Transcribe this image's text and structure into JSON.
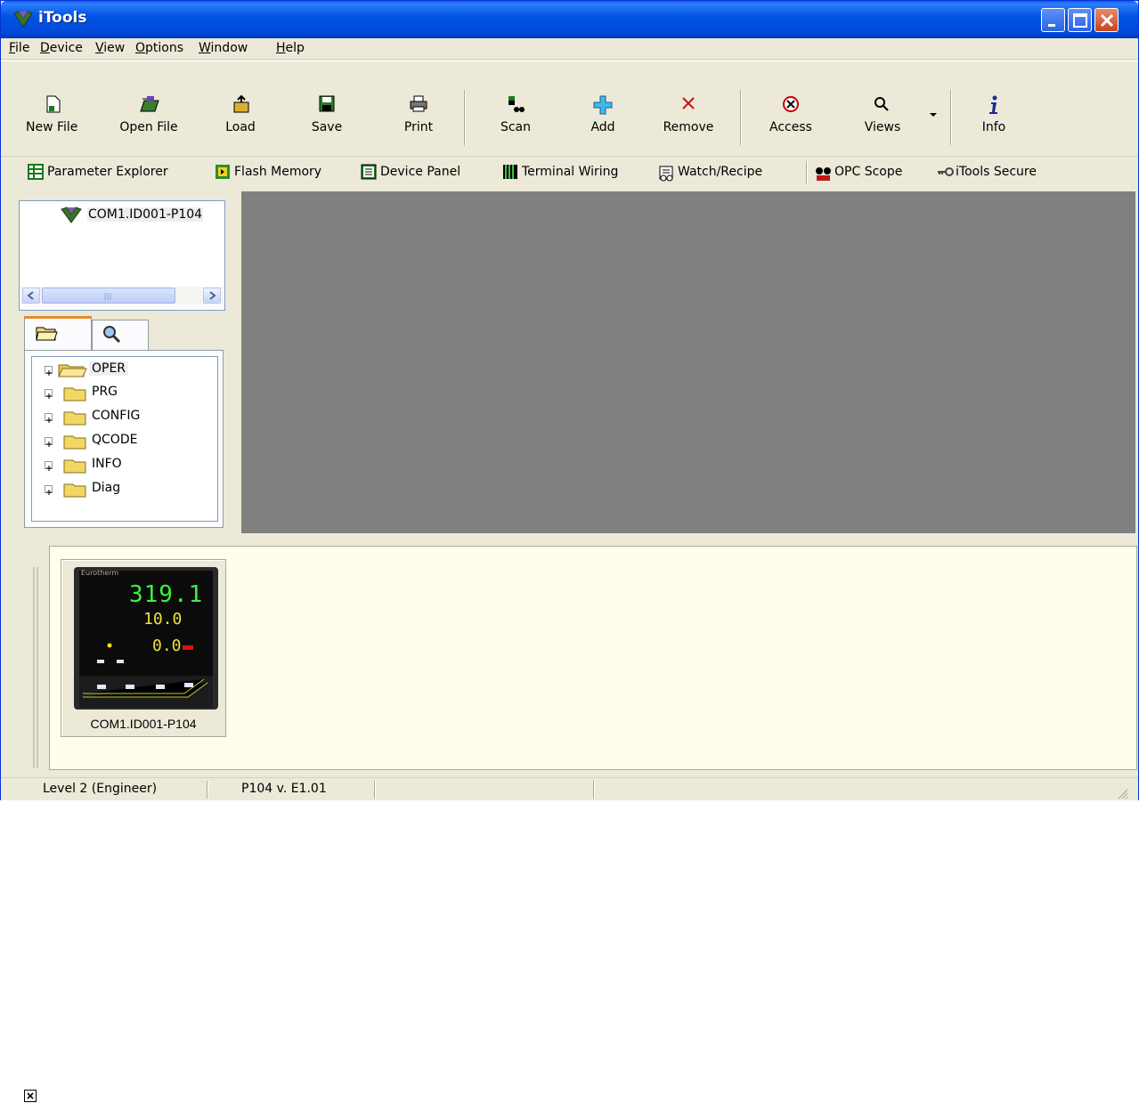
{
  "window": {
    "title": "iTools"
  },
  "menu": [
    "File",
    "Device",
    "View",
    "Options",
    "Window",
    "Help"
  ],
  "toolbar": {
    "new_file": "New File",
    "open_file": "Open File",
    "load": "Load",
    "save": "Save",
    "print": "Print",
    "scan": "Scan",
    "add": "Add",
    "remove": "Remove",
    "access": "Access",
    "views": "Views",
    "info": "Info"
  },
  "toolbar2": {
    "parameter_explorer": "Parameter Explorer",
    "flash_memory": "Flash Memory",
    "device_panel": "Device Panel",
    "terminal_wiring": "Terminal Wiring",
    "watch_recipe": "Watch/Recipe",
    "opc_scope": "OPC Scope",
    "itools_secure": "iTools Secure"
  },
  "device_tree": {
    "node": "COM1.ID001-P104"
  },
  "param_tree": [
    "OPER",
    "PRG",
    "CONFIG",
    "QCODE",
    "INFO",
    "Diag"
  ],
  "device_panel": {
    "caption": "COM1.ID001-P104",
    "brand": "Eurotherm",
    "pv": "319.1",
    "sp1": "10.0",
    "sp2": "0.0"
  },
  "status": {
    "level": "Level 2 (Engineer)",
    "version": "P104 v. E1.01"
  },
  "colors": {
    "title_bar": "#0055e5",
    "workspace": "#808080",
    "device_pane": "#fffeee",
    "access_icon": "#cc0000"
  }
}
